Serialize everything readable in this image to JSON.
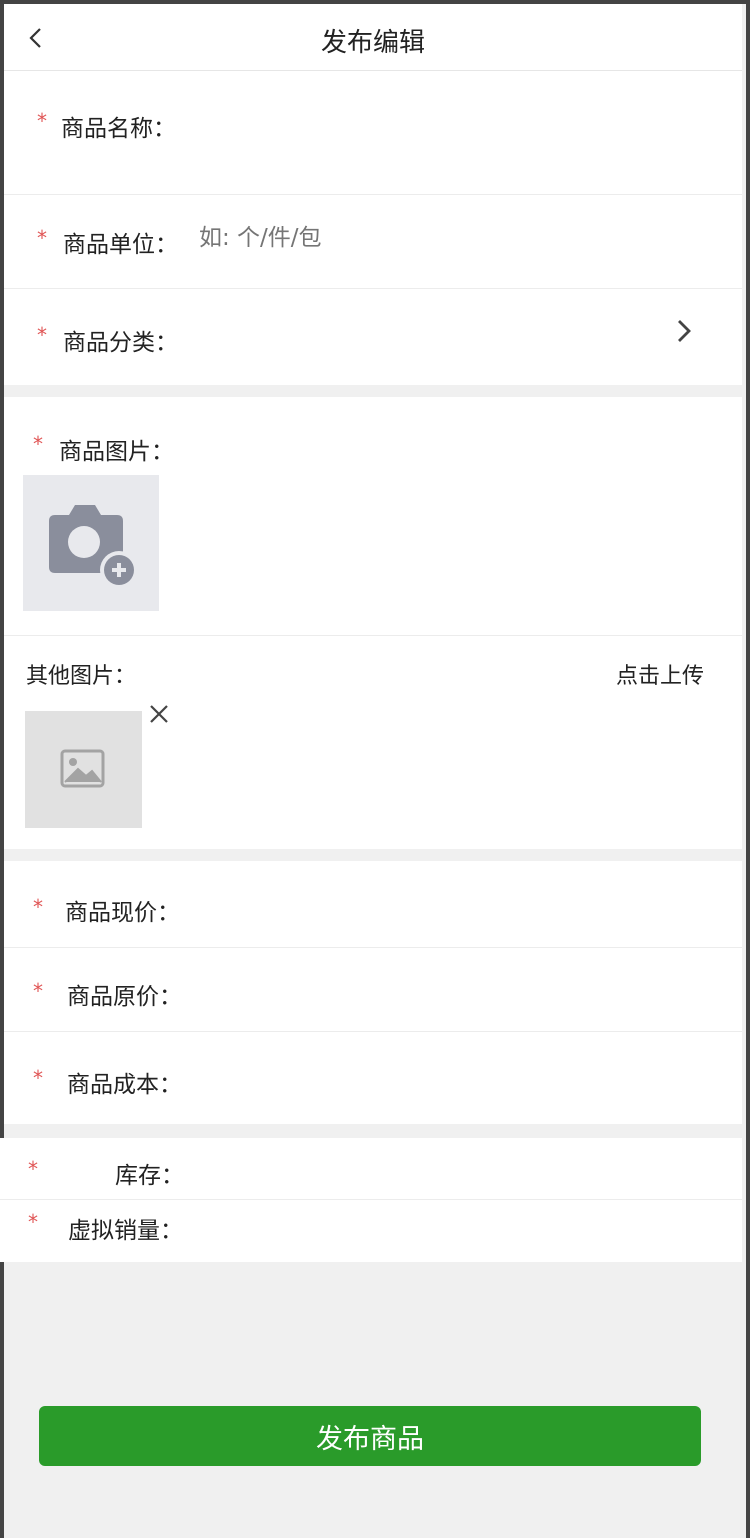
{
  "header": {
    "title": "发布编辑"
  },
  "required_mark": "*",
  "form": {
    "name_label": "商品名称：",
    "unit_label": "商品单位：",
    "unit_placeholder": "如: 个/件/包",
    "category_label": "商品分类：",
    "image_label": "商品图片：",
    "other_images_label": "其他图片：",
    "upload_link": "点击上传",
    "current_price_label": "商品现价：",
    "original_price_label": "商品原价：",
    "cost_label": "商品成本：",
    "stock_label": "库存：",
    "virtual_sales_label": "虚拟销量："
  },
  "submit": {
    "label": "发布商品"
  },
  "icons": {
    "back": "chevron-left-icon",
    "category_arrow": "chevron-right-icon",
    "camera": "camera-add-icon",
    "image": "image-placeholder-icon",
    "close": "close-icon"
  },
  "colors": {
    "accent": "#2a9b2a",
    "required": "#e05555",
    "background": "#f0f0f0"
  }
}
